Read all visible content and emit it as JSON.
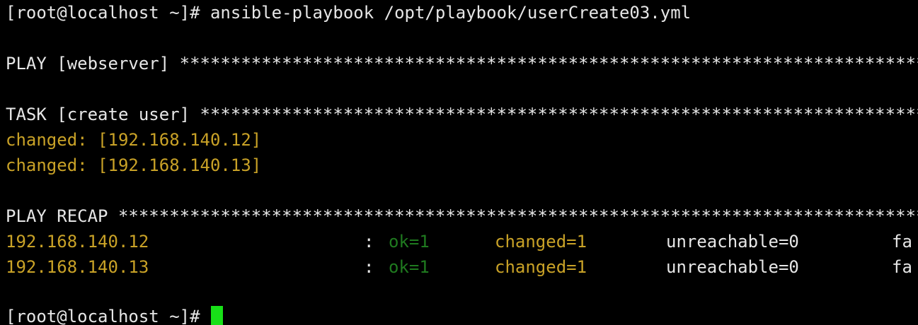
{
  "terminal": {
    "command_line": "[root@localhost ~]# ansible-playbook /opt/playbook/userCreate03.yml",
    "play_line": "PLAY [webserver] ************************************************************************************************",
    "task_line": "TASK [create user] **********************************************************************************************",
    "task_results": [
      "changed: [192.168.140.12]",
      "changed: [192.168.140.13]"
    ],
    "recap_line": "PLAY RECAP **********************************************************************************************************",
    "recap_rows": [
      {
        "host": "192.168.140.12",
        "colon": ":",
        "ok": "ok=1",
        "changed": "changed=1",
        "unreachable": "unreachable=0",
        "failed": "fa"
      },
      {
        "host": "192.168.140.13",
        "colon": ":",
        "ok": "ok=1",
        "changed": "changed=1",
        "unreachable": "unreachable=0",
        "failed": "fa"
      }
    ],
    "prompt": "[root@localhost ~]# "
  },
  "colors": {
    "background": "#000000",
    "default_text": "#e6e6e6",
    "changed": "#c9a227",
    "ok": "#1f7a1f",
    "cursor": "#18e018"
  }
}
